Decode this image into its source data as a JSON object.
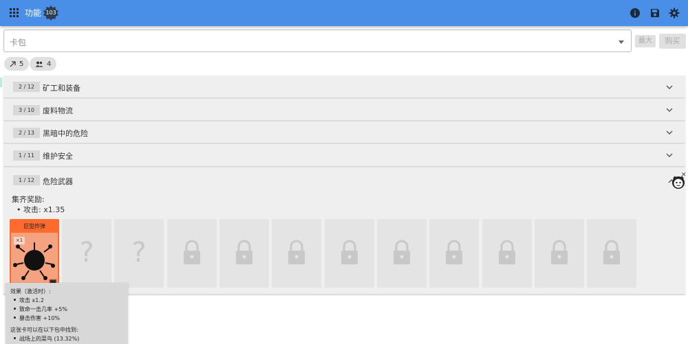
{
  "header": {
    "menu_label": "功能",
    "badge_value": "103",
    "icons": [
      "grid-menu-icon",
      "info-icon",
      "save-icon",
      "gear-icon"
    ],
    "color": "#4a8fe7"
  },
  "pack_selector": {
    "placeholder": "卡包",
    "max_label": "最大",
    "buy_label": "购买"
  },
  "chips": [
    {
      "icon": "arrow-up-right-icon",
      "value": "5"
    },
    {
      "icon": "group-icon",
      "value": "4"
    }
  ],
  "categories": [
    {
      "count": "2 / 12",
      "title": "矿工和装备",
      "expanded": false
    },
    {
      "count": "3 / 10",
      "title": "废料物流",
      "expanded": false
    },
    {
      "count": "2 / 13",
      "title": "黑暗中的危险",
      "expanded": false
    },
    {
      "count": "1 / 11",
      "title": "维护安全",
      "expanded": false
    },
    {
      "count": "1 / 12",
      "title": "危险武器",
      "expanded": true
    }
  ],
  "expanded_panel": {
    "reward_label": "集齐奖励:",
    "reward_items": [
      "攻击: x1.35"
    ],
    "cards": [
      {
        "state": "owned",
        "name": "巨型炸弹",
        "multiplier": "×1"
      },
      {
        "state": "unknown"
      },
      {
        "state": "unknown"
      },
      {
        "state": "locked"
      },
      {
        "state": "locked"
      },
      {
        "state": "locked"
      },
      {
        "state": "locked"
      },
      {
        "state": "locked"
      },
      {
        "state": "locked"
      },
      {
        "state": "locked"
      },
      {
        "state": "locked"
      },
      {
        "state": "locked"
      }
    ]
  },
  "tooltip": {
    "effect_title": "效果（激活时）:",
    "effects": [
      "攻击 x1.2",
      "致命一击几率 +5%",
      "暴击伤害 +10%"
    ],
    "found_in_title": "这张卡可以在以下包中找到:",
    "found_in": [
      "战场上的菜鸟 (13.32%)"
    ]
  },
  "colors": {
    "card_accent": "#ff6a2f",
    "card_bg": "#f4a280"
  }
}
